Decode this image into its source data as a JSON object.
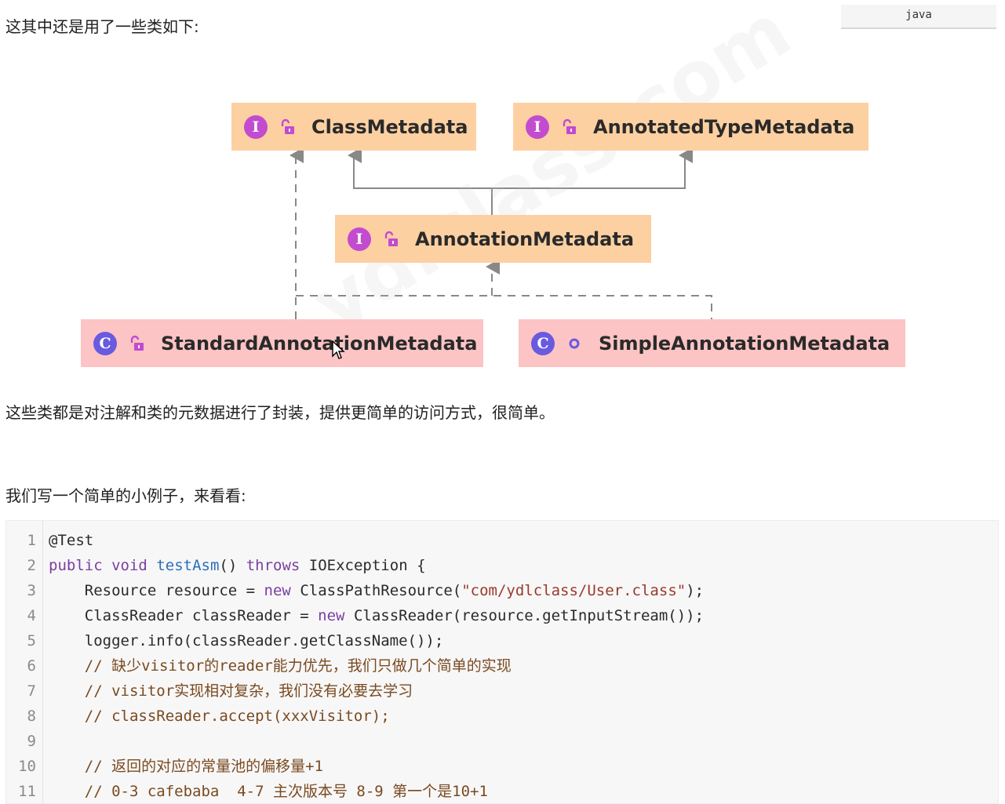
{
  "header": {
    "intro_text": "这其中还是用了一些类如下:",
    "lang_badge": "java"
  },
  "diagram": {
    "nodes": {
      "class_metadata": {
        "badge": "I",
        "label": "ClassMetadata",
        "kind": "interface",
        "visibility_icon": "lock-open-icon"
      },
      "annotated_type_metadata": {
        "badge": "I",
        "label": "AnnotatedTypeMetadata",
        "kind": "interface",
        "visibility_icon": "lock-open-icon"
      },
      "annotation_metadata": {
        "badge": "I",
        "label": "AnnotationMetadata",
        "kind": "interface",
        "visibility_icon": "lock-open-icon"
      },
      "standard_annotation_metadata": {
        "badge": "C",
        "label": "StandardAnnotationMetadata",
        "kind": "class",
        "visibility_icon": "lock-open-icon"
      },
      "simple_annotation_metadata": {
        "badge": "C",
        "label": "SimpleAnnotationMetadata",
        "kind": "class",
        "visibility_icon": "package-private-dot-icon"
      }
    },
    "watermark": "ydlclass.com",
    "colors": {
      "interface_fill": "#fdd0a2",
      "class_fill": "#fcc4c4",
      "interface_badge": "#c24bd0",
      "class_badge": "#6a5ae0",
      "edge": "#888888"
    }
  },
  "body": {
    "description": "这些类都是对注解和类的元数据进行了封装，提供更简单的访问方式，很简单。",
    "example_intro": "我们写一个简单的小例子，来看看:"
  },
  "code": {
    "language": "java",
    "lines": [
      {
        "num": "1",
        "tokens": [
          {
            "t": "pl",
            "v": "@Test"
          }
        ]
      },
      {
        "num": "2",
        "tokens": [
          {
            "t": "kw",
            "v": "public"
          },
          {
            "t": "pl",
            "v": " "
          },
          {
            "t": "kw",
            "v": "void"
          },
          {
            "t": "pl",
            "v": " "
          },
          {
            "t": "fn",
            "v": "testAsm"
          },
          {
            "t": "pl",
            "v": "() "
          },
          {
            "t": "kw",
            "v": "throws"
          },
          {
            "t": "pl",
            "v": " IOException {"
          }
        ]
      },
      {
        "num": "3",
        "tokens": [
          {
            "t": "pl",
            "v": "    Resource resource = "
          },
          {
            "t": "kw",
            "v": "new"
          },
          {
            "t": "pl",
            "v": " ClassPathResource("
          },
          {
            "t": "str",
            "v": "\"com/ydlclass/User.class\""
          },
          {
            "t": "pl",
            "v": ");"
          }
        ]
      },
      {
        "num": "4",
        "tokens": [
          {
            "t": "pl",
            "v": "    ClassReader classReader = "
          },
          {
            "t": "kw",
            "v": "new"
          },
          {
            "t": "pl",
            "v": " ClassReader(resource.getInputStream());"
          }
        ]
      },
      {
        "num": "5",
        "tokens": [
          {
            "t": "pl",
            "v": "    logger.info(classReader.getClassName());"
          }
        ]
      },
      {
        "num": "6",
        "tokens": [
          {
            "t": "cm",
            "v": "    // 缺少visitor的reader能力优先，我们只做几个简单的实现"
          }
        ]
      },
      {
        "num": "7",
        "tokens": [
          {
            "t": "cm",
            "v": "    // visitor实现相对复杂，我们没有必要去学习"
          }
        ]
      },
      {
        "num": "8",
        "tokens": [
          {
            "t": "cm",
            "v": "    // classReader.accept(xxxVisitor);"
          }
        ]
      },
      {
        "num": "9",
        "tokens": []
      },
      {
        "num": "10",
        "tokens": [
          {
            "t": "cm",
            "v": "    // 返回的对应的常量池的偏移量+1"
          }
        ]
      },
      {
        "num": "11",
        "tokens": [
          {
            "t": "cm",
            "v": "    // 0-3 cafebaba  4-7 主次版本号 8-9 第一个是10+1"
          }
        ]
      }
    ]
  }
}
